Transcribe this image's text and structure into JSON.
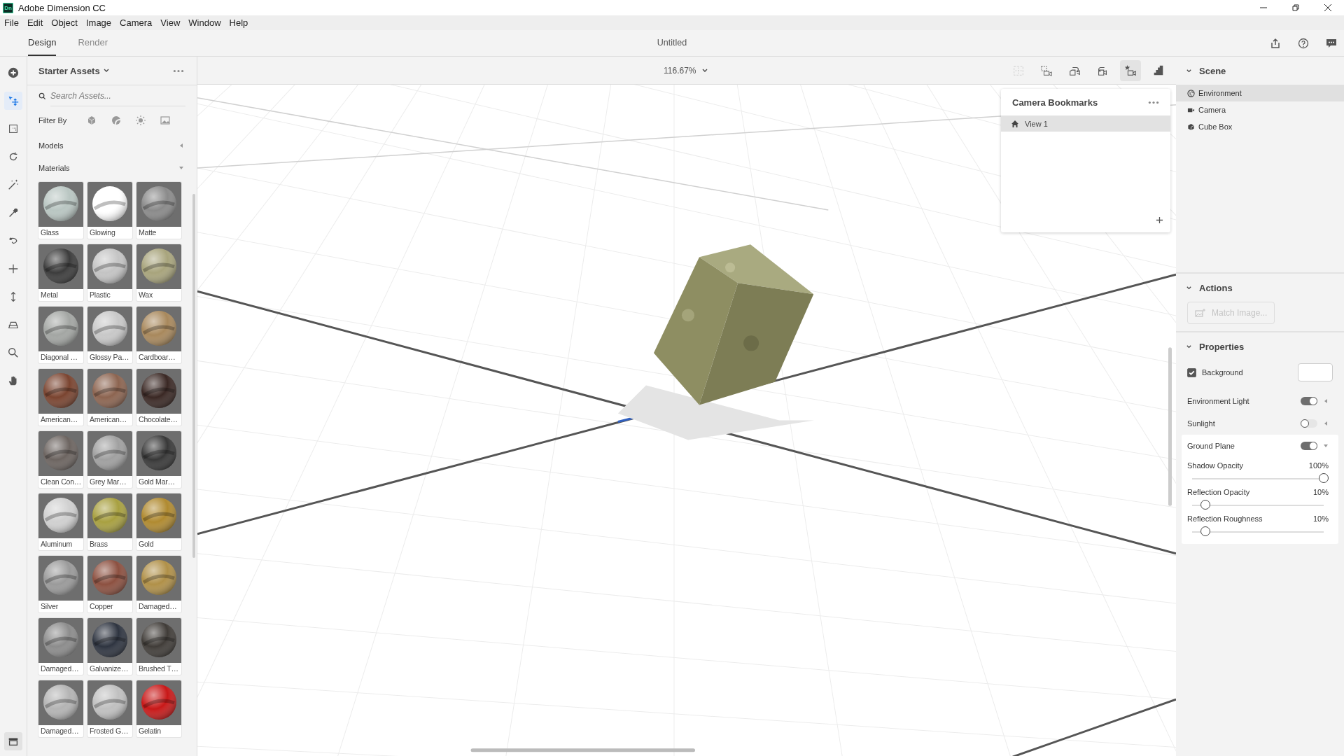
{
  "window": {
    "logo": "Dn",
    "title": "Adobe Dimension CC"
  },
  "menu": [
    "File",
    "Edit",
    "Object",
    "Image",
    "Camera",
    "View",
    "Window",
    "Help"
  ],
  "mode_tabs": [
    {
      "label": "Design",
      "selected": true
    },
    {
      "label": "Render",
      "selected": false
    }
  ],
  "document_title": "Untitled",
  "tools": [
    {
      "kind": "select",
      "selected": true
    },
    {
      "kind": "marquee",
      "selected": false
    },
    {
      "kind": "rotate",
      "selected": false
    },
    {
      "kind": "wand",
      "selected": false
    },
    {
      "kind": "eyedropper",
      "selected": false
    },
    {
      "kind": "orbit",
      "selected": false
    },
    {
      "kind": "pan",
      "selected": false
    },
    {
      "kind": "dolly",
      "selected": false
    },
    {
      "kind": "horizon",
      "selected": false
    },
    {
      "kind": "zoom",
      "selected": false
    },
    {
      "kind": "hand",
      "selected": false
    }
  ],
  "assets_panel": {
    "title": "Starter Assets",
    "search": {
      "placeholder": "Search Assets..."
    },
    "filter_label": "Filter By",
    "sections": [
      {
        "label": "Models",
        "expanded": false
      },
      {
        "label": "Materials",
        "expanded": true
      }
    ],
    "materials": [
      {
        "label": "Glass",
        "color": "#b9c6c2"
      },
      {
        "label": "Glowing",
        "color": "#ffffff"
      },
      {
        "label": "Matte",
        "color": "#8a8a8a"
      },
      {
        "label": "Metal",
        "color": "#3c3c3c"
      },
      {
        "label": "Plastic",
        "color": "#c4c4c4"
      },
      {
        "label": "Wax",
        "color": "#a8a47c"
      },
      {
        "label": "Diagonal …",
        "color": "#a3a6a3"
      },
      {
        "label": "Glossy Pa…",
        "color": "#c8c8c8"
      },
      {
        "label": "Cardboar…",
        "color": "#a8885c"
      },
      {
        "label": "American…",
        "color": "#7a4430"
      },
      {
        "label": "American…",
        "color": "#8c6450"
      },
      {
        "label": "Chocolate…",
        "color": "#3a2824"
      },
      {
        "label": "Clean Con…",
        "color": "#6c6460"
      },
      {
        "label": "Grey Mar…",
        "color": "#a0a0a0"
      },
      {
        "label": "Gold Mar…",
        "color": "#383838"
      },
      {
        "label": "Aluminum",
        "color": "#d0d0d0"
      },
      {
        "label": "Brass",
        "color": "#a8a040"
      },
      {
        "label": "Gold",
        "color": "#b08a30"
      },
      {
        "label": "Silver",
        "color": "#9a9a9a"
      },
      {
        "label": "Copper",
        "color": "#8c5040"
      },
      {
        "label": "Damaged…",
        "color": "#b09048"
      },
      {
        "label": "Damaged…",
        "color": "#8c8c8c"
      },
      {
        "label": "Galvanize…",
        "color": "#2e3440"
      },
      {
        "label": "Brushed T…",
        "color": "#403c38"
      },
      {
        "label": "Damaged…",
        "color": "#b4b4b4"
      },
      {
        "label": "Frosted G…",
        "color": "#c0c0c0"
      },
      {
        "label": "Gelatin",
        "color": "#c81818"
      }
    ]
  },
  "viewport": {
    "zoom": "116.67%",
    "camera_tools": [
      {
        "kind": "frame",
        "selected": false,
        "disabled": true
      },
      {
        "kind": "fit",
        "selected": false,
        "disabled": false
      },
      {
        "kind": "undo",
        "selected": false,
        "disabled": false
      },
      {
        "kind": "redo",
        "selected": false,
        "disabled": false
      },
      {
        "kind": "bookmark",
        "selected": true,
        "disabled": false
      },
      {
        "kind": "preview",
        "selected": false,
        "disabled": false
      }
    ]
  },
  "bookmarks_popup": {
    "title": "Camera Bookmarks",
    "items": [
      {
        "label": "View 1",
        "selected": true
      }
    ]
  },
  "scene": {
    "title": "Scene",
    "expanded": true,
    "items": [
      {
        "label": "Environment",
        "kind": "environment",
        "selected": true
      },
      {
        "label": "Camera",
        "kind": "camera",
        "selected": false
      },
      {
        "label": "Cube Box",
        "kind": "model",
        "selected": false
      }
    ]
  },
  "actions": {
    "title": "Actions",
    "expanded": true,
    "button": {
      "label": "Match Image...",
      "disabled": true
    }
  },
  "properties": {
    "title": "Properties",
    "expanded": true,
    "background": {
      "label": "Background",
      "checked": true,
      "color": "#ffffff"
    },
    "items": [
      {
        "label": "Environment Light",
        "on": true,
        "expanded": false
      },
      {
        "label": "Sunlight",
        "on": false,
        "expanded": false
      },
      {
        "label": "Ground Plane",
        "on": true,
        "expanded": true,
        "sliders": [
          {
            "label": "Shadow Opacity",
            "reading": "100%",
            "level": 1
          },
          {
            "label": "Reflection Opacity",
            "reading": "10%",
            "level": 0.1
          },
          {
            "label": "Reflection Roughness",
            "reading": "10%",
            "level": 0.1
          }
        ]
      }
    ]
  }
}
